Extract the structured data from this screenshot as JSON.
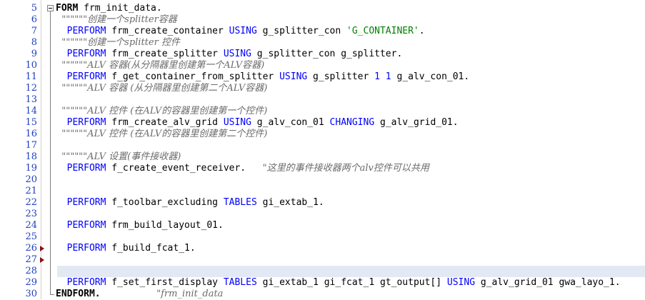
{
  "editor": {
    "lines": [
      {
        "num": "5",
        "segments": [
          {
            "c": "b",
            "t": "FORM"
          },
          {
            "c": "t",
            "t": " frm_init_data."
          }
        ]
      },
      {
        "num": "6",
        "segments": [
          {
            "c": "cm",
            "t": "  \"\"\"\"\"\"创建一个splitter容器"
          }
        ]
      },
      {
        "num": "7",
        "segments": [
          {
            "c": "kw",
            "t": "  PERFORM"
          },
          {
            "c": "t",
            "t": " frm_create_container "
          },
          {
            "c": "kw",
            "t": "USING"
          },
          {
            "c": "t",
            "t": " g_splitter_con "
          },
          {
            "c": "str",
            "t": "'G_CONTAINER'"
          },
          {
            "c": "t",
            "t": "."
          }
        ]
      },
      {
        "num": "8",
        "segments": [
          {
            "c": "cm",
            "t": "  \"\"\"\"\"\"创建一个splitter 控件"
          }
        ]
      },
      {
        "num": "9",
        "segments": [
          {
            "c": "kw",
            "t": "  PERFORM"
          },
          {
            "c": "t",
            "t": " frm_create_splitter "
          },
          {
            "c": "kw",
            "t": "USING"
          },
          {
            "c": "t",
            "t": " g_splitter_con g_splitter."
          }
        ]
      },
      {
        "num": "10",
        "segments": [
          {
            "c": "cm",
            "t": "  \"\"\"\"\"\"ALV 容器(从分隔器里创建第一个ALV容器)"
          }
        ]
      },
      {
        "num": "11",
        "segments": [
          {
            "c": "kw",
            "t": "  PERFORM"
          },
          {
            "c": "t",
            "t": " f_get_container_from_splitter "
          },
          {
            "c": "kw",
            "t": "USING"
          },
          {
            "c": "t",
            "t": " g_splitter "
          },
          {
            "c": "num",
            "t": "1 1"
          },
          {
            "c": "t",
            "t": " g_alv_con_01."
          }
        ]
      },
      {
        "num": "12",
        "segments": [
          {
            "c": "cm",
            "t": "  \"\"\"\"\"\"ALV 容器 (从分隔器里创建第二个ALV容器)"
          }
        ]
      },
      {
        "num": "13",
        "segments": []
      },
      {
        "num": "14",
        "segments": [
          {
            "c": "cm",
            "t": "  \"\"\"\"\"\"ALV 控件 (在ALV的容器里创建第一个控件)"
          }
        ]
      },
      {
        "num": "15",
        "segments": [
          {
            "c": "kw",
            "t": "  PERFORM"
          },
          {
            "c": "t",
            "t": " frm_create_alv_grid "
          },
          {
            "c": "kw",
            "t": "USING"
          },
          {
            "c": "t",
            "t": " g_alv_con_01 "
          },
          {
            "c": "kw",
            "t": "CHANGING"
          },
          {
            "c": "t",
            "t": " g_alv_grid_01."
          }
        ]
      },
      {
        "num": "16",
        "segments": [
          {
            "c": "cm",
            "t": "  \"\"\"\"\"\"ALV 控件 (在ALV的容器里创建第二个控件)"
          }
        ]
      },
      {
        "num": "17",
        "segments": []
      },
      {
        "num": "18",
        "segments": [
          {
            "c": "cm",
            "t": "  \"\"\"\"\"\"ALV 设置(事件接收器)"
          }
        ]
      },
      {
        "num": "19",
        "segments": [
          {
            "c": "kw",
            "t": "  PERFORM"
          },
          {
            "c": "t",
            "t": " f_create_event_receiver.   "
          },
          {
            "c": "cm",
            "t": "\"这里的事件接收器两个alv控件可以共用"
          }
        ]
      },
      {
        "num": "20",
        "segments": []
      },
      {
        "num": "21",
        "segments": []
      },
      {
        "num": "22",
        "segments": [
          {
            "c": "kw",
            "t": "  PERFORM"
          },
          {
            "c": "t",
            "t": " f_toolbar_excluding "
          },
          {
            "c": "kw",
            "t": "TABLES"
          },
          {
            "c": "t",
            "t": " gi_extab_1."
          }
        ]
      },
      {
        "num": "23",
        "segments": []
      },
      {
        "num": "24",
        "segments": [
          {
            "c": "kw",
            "t": "  PERFORM"
          },
          {
            "c": "t",
            "t": " frm_build_layout_01."
          }
        ]
      },
      {
        "num": "25",
        "segments": []
      },
      {
        "num": "26",
        "segments": [
          {
            "c": "kw",
            "t": "  PERFORM"
          },
          {
            "c": "t",
            "t": " f_build_fcat_1."
          }
        ]
      },
      {
        "num": "27",
        "segments": []
      },
      {
        "num": "28",
        "segments": []
      },
      {
        "num": "29",
        "segments": [
          {
            "c": "kw",
            "t": "  PERFORM"
          },
          {
            "c": "t",
            "t": " f_set_first_display "
          },
          {
            "c": "kw",
            "t": "TABLES"
          },
          {
            "c": "t",
            "t": " gi_extab_1 gi_fcat_1 gt_output[] "
          },
          {
            "c": "kw",
            "t": "USING"
          },
          {
            "c": "t",
            "t": " g_alv_grid_01 gwa_layo_1."
          }
        ]
      },
      {
        "num": "30",
        "segments": [
          {
            "c": "b",
            "t": "ENDFORM."
          },
          {
            "c": "cm",
            "t": "                   \"frm_init_data"
          }
        ]
      }
    ],
    "breakpoint_lines": [
      "26",
      "27"
    ],
    "highlighted_line": "28"
  }
}
